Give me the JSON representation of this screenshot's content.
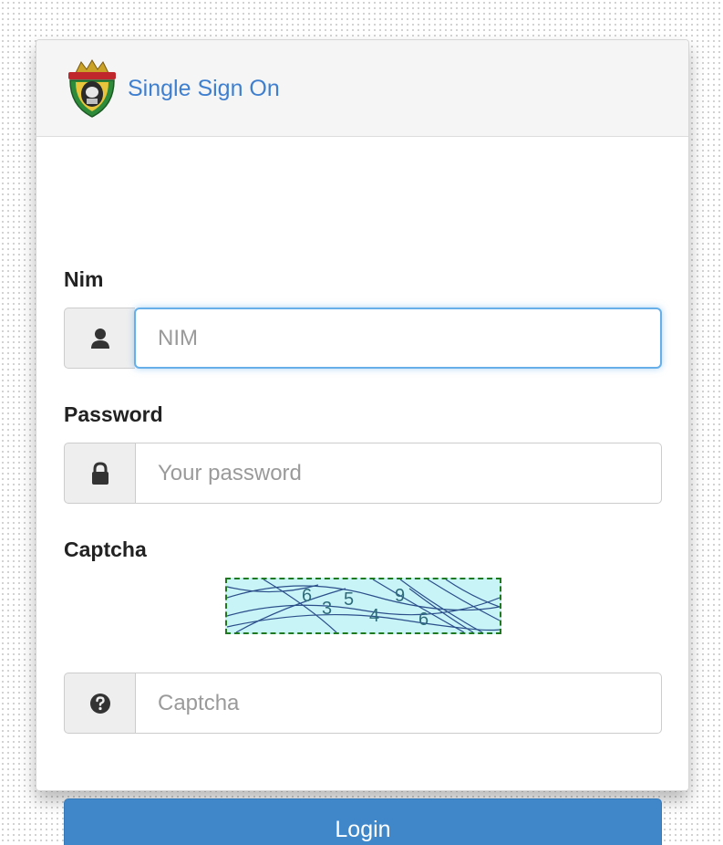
{
  "header": {
    "title": "Single Sign On",
    "logo_icon": "university-crest-icon"
  },
  "form": {
    "nim": {
      "label": "Nim",
      "placeholder": "NIM",
      "value": "",
      "icon": "user-icon"
    },
    "password": {
      "label": "Password",
      "placeholder": "Your password",
      "value": "",
      "icon": "lock-icon"
    },
    "captcha": {
      "label": "Captcha",
      "image_text": "635496",
      "placeholder": "Captcha",
      "value": "",
      "icon": "question-circle-icon"
    },
    "submit_label": "Login"
  },
  "colors": {
    "accent": "#3f87c9",
    "title": "#3f7fcf",
    "focus_border": "#66afe9",
    "captcha_bg": "#c8f4f8"
  }
}
